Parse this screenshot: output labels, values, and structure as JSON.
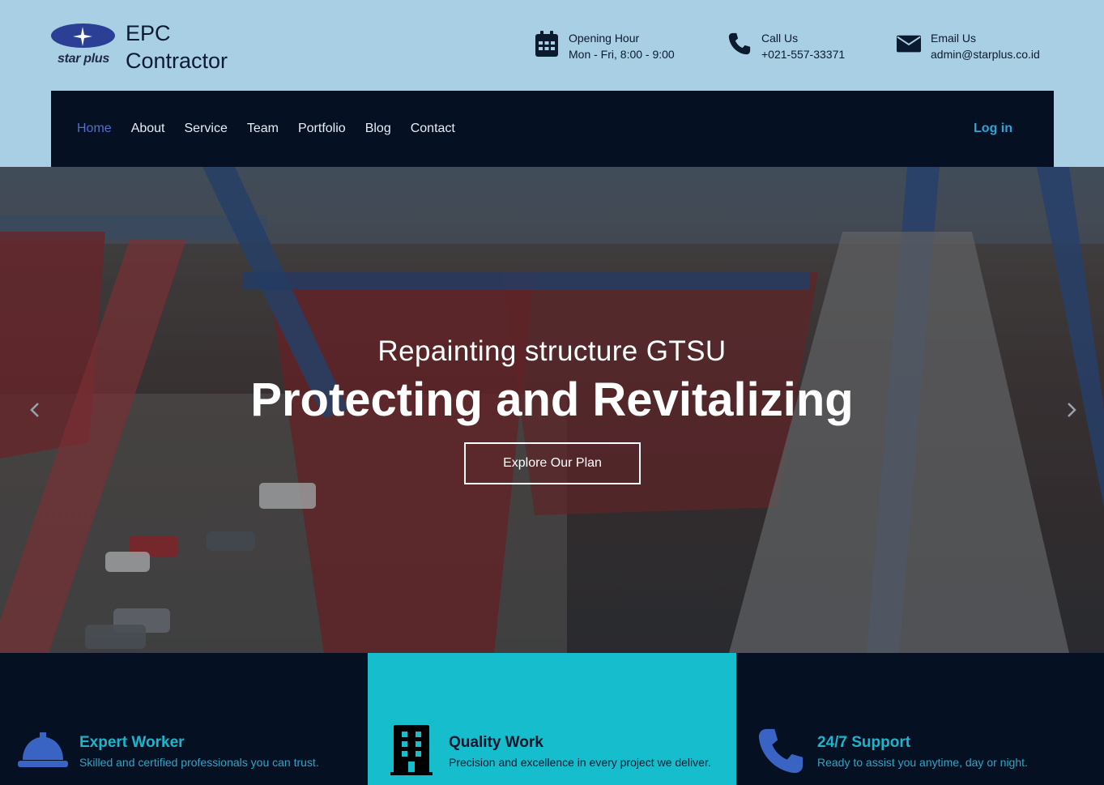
{
  "brand": {
    "logo_text": "star plus",
    "name_line1": "EPC",
    "name_line2": "Contractor"
  },
  "header_info": {
    "hours": {
      "icon": "calendar-icon",
      "label": "Opening Hour",
      "value": "Mon - Fri, 8:00 - 9:00"
    },
    "call": {
      "icon": "phone-icon",
      "label": "Call Us",
      "value": "+021-557-33371"
    },
    "email": {
      "icon": "envelope-icon",
      "label": "Email Us",
      "value": "admin@starplus.co.id"
    }
  },
  "nav": {
    "items": [
      {
        "label": "Home",
        "active": true
      },
      {
        "label": "About"
      },
      {
        "label": "Service"
      },
      {
        "label": "Team"
      },
      {
        "label": "Portfolio"
      },
      {
        "label": "Blog"
      },
      {
        "label": "Contact"
      }
    ],
    "login_label": "Log in"
  },
  "hero": {
    "subtitle": "Repainting structure GTSU",
    "title": "Protecting and Revitalizing",
    "button_label": "Explore Our Plan"
  },
  "features": [
    {
      "icon": "hard-hat-icon",
      "title": "Expert Worker",
      "description": "Skilled and certified professionals you can trust."
    },
    {
      "icon": "building-icon",
      "title": "Quality Work",
      "description": "Precision and excellence in every project we deliver."
    },
    {
      "icon": "phone-icon",
      "title": "24/7 Support",
      "description": "Ready to assist you anytime, day or night."
    }
  ],
  "colors": {
    "header_bg": "#a9cfe4",
    "nav_bg": "#051022",
    "nav_active": "#4f71c7",
    "login": "#2ea4d4",
    "feature_highlight": "#16bdcc",
    "feature_accent": "#1bb6cb"
  }
}
